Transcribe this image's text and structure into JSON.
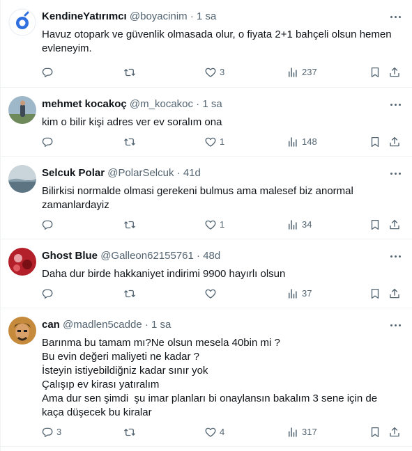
{
  "tweets": [
    {
      "name": "KendineYatırımcı",
      "handle": "@boyacinim",
      "separator": "·",
      "time": "1 sa",
      "lines": [
        "Havuz otopark ve güvenlik olmasada olur, o fiyata 2+1 bahçeli olsun hemen",
        "evleneyim."
      ],
      "replies": "",
      "retweets": "",
      "likes": "3",
      "views": "237",
      "avatar_colors": [
        "#2f6fe0",
        "#ffffff"
      ]
    },
    {
      "name": "mehmet kocakoç",
      "handle": "@m_kocakoc",
      "separator": "·",
      "time": "1 sa",
      "lines": [
        "kim o bilir kişi adres ver ev soralım ona"
      ],
      "replies": "",
      "retweets": "",
      "likes": "1",
      "views": "148",
      "avatar_colors": [
        "#9fb8c9",
        "#3d4a56"
      ]
    },
    {
      "name": "Selcuk Polar",
      "handle": "@PolarSelcuk",
      "separator": "·",
      "time": "41d",
      "lines": [
        "Bilirkisi normalde olmasi gerekeni bulmus ama malesef biz anormal",
        "zamanlardayiz"
      ],
      "replies": "",
      "retweets": "",
      "likes": "1",
      "views": "34",
      "avatar_colors": [
        "#c9d4db",
        "#5d7483"
      ]
    },
    {
      "name": "Ghost Blue",
      "handle": "@Galleon62155761",
      "separator": "·",
      "time": "48d",
      "lines": [
        "Daha dur birde hakkaniyet indirimi 9900 hayırlı olsun"
      ],
      "replies": "",
      "retweets": "",
      "likes": "",
      "views": "37",
      "avatar_colors": [
        "#b3202a",
        "#e8a0a4"
      ]
    },
    {
      "name": "can",
      "handle": "@madlen5cadde",
      "separator": "·",
      "time": "1 sa",
      "lines": [
        "Barınma bu tamam mı?Ne olsun mesela 40bin mi ?",
        "Bu evin değeri maliyeti ne kadar ?",
        "İsteyin istiyebildiğniz kadar sınır yok",
        "Çalışıp ev kirası yatıralım",
        "Ama dur sen şimdi  şu imar planları bi onaylansın bakalım 3 sene için de",
        "kaça düşecek bu kiralar"
      ],
      "replies": "3",
      "retweets": "",
      "likes": "4",
      "views": "317",
      "avatar_colors": [
        "#c58a3c",
        "#3a2a1a"
      ]
    }
  ],
  "icons": {
    "reply": "reply-icon",
    "retweet": "retweet-icon",
    "like": "like-icon",
    "views": "views-icon",
    "bookmark": "bookmark-icon",
    "share": "share-icon",
    "more": "more-icon"
  },
  "colors": {
    "text": "#0f1419",
    "muted": "#536471",
    "divider": "#eff3f4"
  }
}
